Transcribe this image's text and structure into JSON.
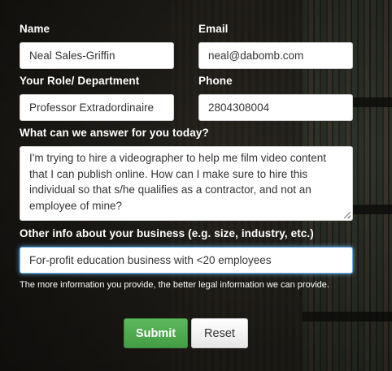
{
  "form": {
    "name_label": "Name",
    "name_value": "Neal Sales-Griffin",
    "email_label": "Email",
    "email_value": "neal@dabomb.com",
    "role_label": "Your Role/ Department",
    "role_value": "Professor Extradordinaire",
    "phone_label": "Phone",
    "phone_value": "2804308004",
    "question_label": "What can we answer for you today?",
    "question_value": "I'm trying to hire a videographer to help me film video content that I can publish online. How can I make sure to hire this individual so that s/he qualifies as a contractor, and not an employee of mine?",
    "other_label": "Other info about your business (e.g. size, industry, etc.)",
    "other_value": "For-profit education business with <20 employees",
    "help_text": "The more information you provide, the better legal information we can provide.",
    "submit_label": "Submit",
    "reset_label": "Reset"
  },
  "colors": {
    "submit": "#5cb85c",
    "focus_ring": "#66afe9",
    "label_text": "#ffffff"
  }
}
